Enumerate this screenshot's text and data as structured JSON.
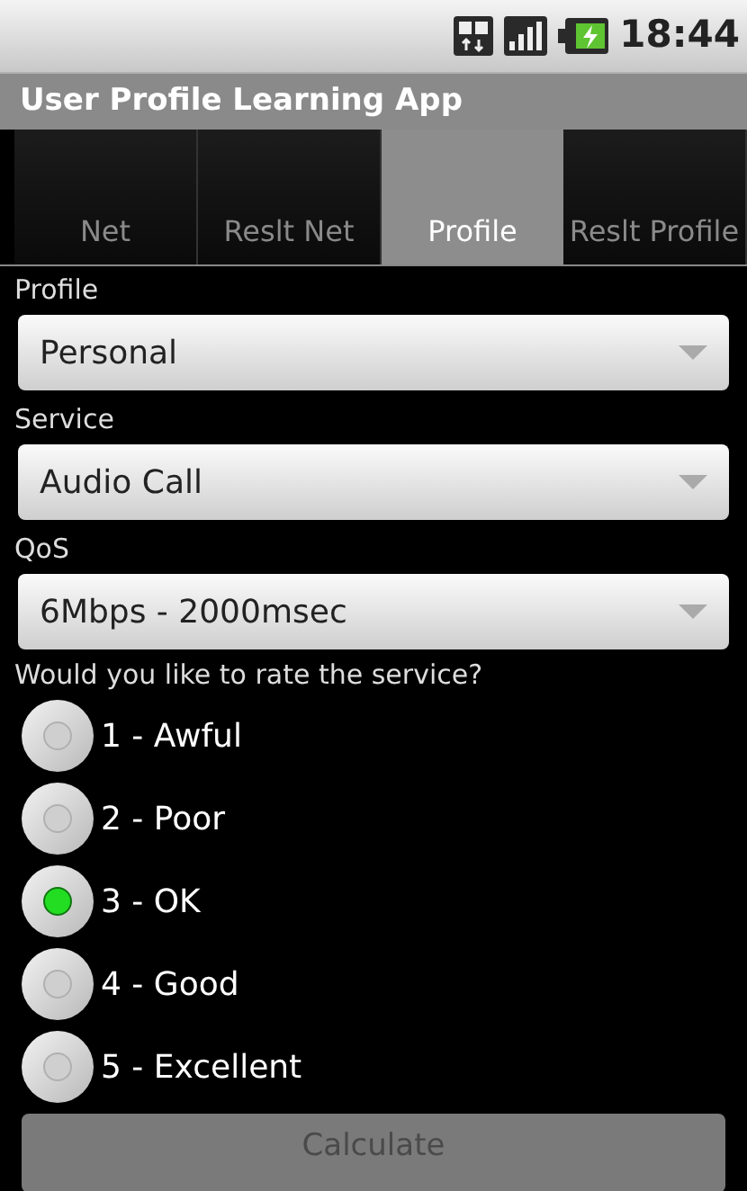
{
  "status_bar": {
    "time": "18:44"
  },
  "window": {
    "title": "User Profile Learning App"
  },
  "tabs": [
    {
      "label": "Net",
      "selected": false
    },
    {
      "label": "Reslt Net",
      "selected": false
    },
    {
      "label": "Profile",
      "selected": true
    },
    {
      "label": "Reslt Profile",
      "selected": false
    }
  ],
  "fields": [
    {
      "label": "Profile",
      "value": "Personal"
    },
    {
      "label": "Service",
      "value": "Audio Call"
    },
    {
      "label": "QoS",
      "value": "6Mbps - 2000msec"
    }
  ],
  "rating": {
    "question": "Would you like to rate the service?",
    "options": [
      {
        "label": "1 - Awful",
        "selected": false
      },
      {
        "label": "2 - Poor",
        "selected": false
      },
      {
        "label": "3 - OK",
        "selected": true
      },
      {
        "label": "4 - Good",
        "selected": false
      },
      {
        "label": "5 - Excellent",
        "selected": false
      }
    ]
  },
  "button": {
    "label": "Calculate",
    "disabled": true
  }
}
